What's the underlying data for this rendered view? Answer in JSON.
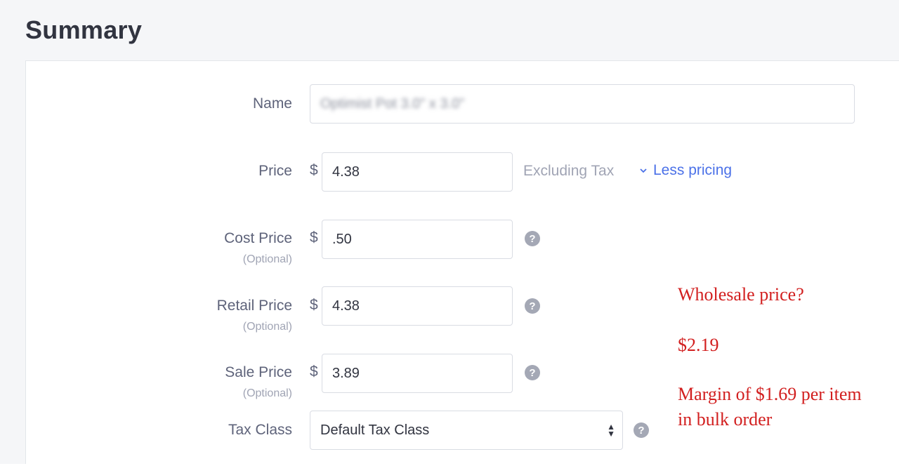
{
  "page": {
    "title": "Summary"
  },
  "fields": {
    "name": {
      "label": "Name",
      "value": "Optimist Pot 3.0\" x 3.0\""
    },
    "price": {
      "label": "Price",
      "currency": "$",
      "value": "4.38",
      "tax_note": "Excluding Tax",
      "toggle_label": "Less pricing"
    },
    "cost_price": {
      "label": "Cost Price",
      "sublabel": "(Optional)",
      "currency": "$",
      "value": ".50",
      "help": "?"
    },
    "retail_price": {
      "label": "Retail Price",
      "sublabel": "(Optional)",
      "currency": "$",
      "value": "4.38",
      "help": "?"
    },
    "sale_price": {
      "label": "Sale Price",
      "sublabel": "(Optional)",
      "currency": "$",
      "value": "3.89",
      "help": "?"
    },
    "tax_class": {
      "label": "Tax Class",
      "value": "Default Tax Class",
      "help": "?"
    }
  },
  "annotation": {
    "line1": "Wholesale price?",
    "line2": "$2.19",
    "line3": "Margin of $1.69 per item",
    "line4": "in bulk order",
    "color": "#d21f1f"
  },
  "colors": {
    "link": "#4b71e8",
    "help_icon": "#a4a8b5"
  }
}
